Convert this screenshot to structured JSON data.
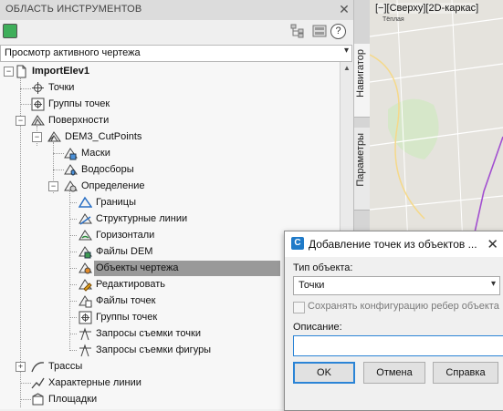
{
  "toolspace": {
    "title": "ОБЛАСТЬ ИНСТРУМЕНТОВ",
    "close_glyph": "✕",
    "help_glyph": "?",
    "view_dropdown": "Просмотр активного чертежа",
    "dropdown_arrow": "▾",
    "scroll_up": "▲",
    "tabs": {
      "navigator": "Навигатор",
      "settings": "Параметры"
    }
  },
  "tree": {
    "drawing": "ImportElev1",
    "points": "Точки",
    "point_groups": "Группы точек",
    "surfaces": "Поверхности",
    "surface_name": "DEM3_CutPoints",
    "masks": "Маски",
    "watersheds": "Водосборы",
    "definition": "Определение",
    "boundaries": "Границы",
    "breaklines": "Структурные линии",
    "contours": "Горизонтали",
    "dem_files": "Файлы DEM",
    "drawing_objects": "Объекты чертежа",
    "edits": "Редактировать",
    "point_files": "Файлы точек",
    "def_point_groups": "Группы точек",
    "survey_queries_point": "Запросы съемки точки",
    "survey_queries_figure": "Запросы съемки фигуры",
    "alignments": "Трассы",
    "feature_lines": "Характерные линии",
    "sites": "Площадки",
    "expand_minus": "−",
    "expand_plus": "+"
  },
  "viewport": {
    "label": "[−][Сверху][2D-каркас]",
    "map_text": "Тёплая"
  },
  "dialog": {
    "title": "Добавление точек из объектов ...",
    "close_glyph": "✕",
    "object_type_label": "Тип объекта:",
    "object_type_value": "Точки",
    "maintain_edges_label": "Сохранять конфигурацию ребер объекта",
    "maintain_edges_checked": false,
    "description_label": "Описание:",
    "description_value": "",
    "ok_label": "OK",
    "cancel_label": "Отмена",
    "help_label": "Справка"
  },
  "colors": {
    "selection": "#999999",
    "accent": "#2b84d6",
    "map_route": "#a24fd0"
  }
}
